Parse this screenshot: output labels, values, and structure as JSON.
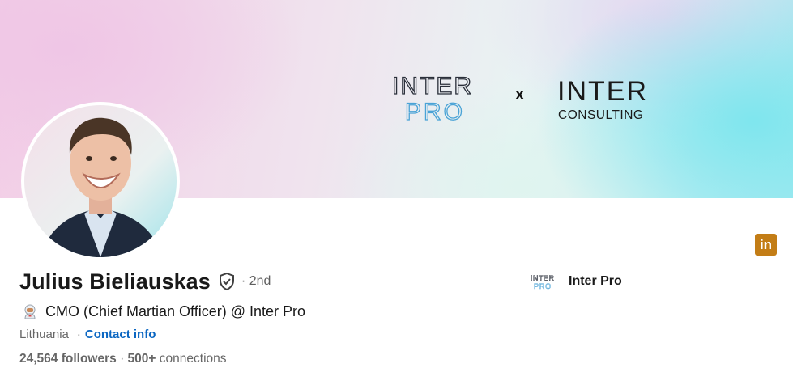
{
  "banner": {
    "logo_left": {
      "line1": "INTER",
      "line2": "PRO"
    },
    "separator": "x",
    "logo_right": {
      "line1": "INTER",
      "line2": "CONSULTING"
    }
  },
  "profile": {
    "name": "Julius Bieliauskas",
    "degree": "· 2nd",
    "headline_icon": "astronaut-emoji",
    "headline": "CMO (Chief Martian Officer) @ Inter Pro",
    "location": "Lithuania",
    "location_separator": "·",
    "contact_info": "Contact info",
    "followers_count": "24,564 followers",
    "stats_separator": " · ",
    "connections_count": "500+",
    "connections_label": " connections"
  },
  "company": {
    "logo_line1": "INTER",
    "logo_line2": "PRO",
    "name": "Inter Pro"
  },
  "badges": {
    "linkedin": "in"
  },
  "icons": [
    "verified-shield-icon",
    "linkedin-icon",
    "astronaut-emoji-icon"
  ],
  "colors": {
    "link": "#0a66c2",
    "linkedin_badge": "#c37d16",
    "logo_blue": "#4aa3d6"
  }
}
